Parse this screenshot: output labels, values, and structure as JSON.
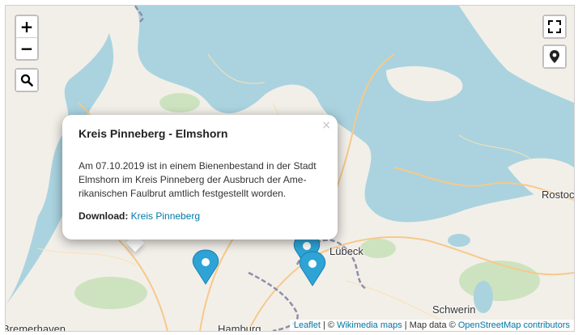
{
  "map": {
    "places": {
      "luebeck": "Lübeck",
      "rostock": "Rostoc",
      "schwerin": "Schwerin",
      "hamburg": "Hamburg",
      "bremerhaven": "Bremerhaven"
    },
    "colors": {
      "water": "#aad3df",
      "land": "#f2efe9",
      "forest": "#cde3bf",
      "road": "#f6c98a",
      "border": "#8e8ea8",
      "marker": "#2ea4d6"
    }
  },
  "controls": {
    "zoom_in": "+",
    "zoom_out": "−",
    "search_icon": "search-icon",
    "fullscreen_icon": "fullscreen-icon",
    "locate_icon": "map-pin-icon"
  },
  "popup": {
    "title": "Kreis Pinneberg - Elmshorn",
    "body": "Am 07.10.2019 ist in einem Bienenbestand in der Stadt Elmshorn im Kreis Pinneberg der Ausbruch der Ame-rikanischen Faulbrut amtlich festgestellt worden.",
    "download_label": "Download:",
    "download_link": "Kreis Pinneberg",
    "close": "×"
  },
  "attribution": {
    "leaflet": "Leaflet",
    "separator": " | © ",
    "wikimedia": "Wikimedia maps",
    "mapdata": " | Map data © ",
    "osm": "OpenStreetMap contributors"
  },
  "markers": [
    {
      "name": "Elmshorn"
    },
    {
      "name": "Lübeck-area-1"
    },
    {
      "name": "Lübeck-area-2"
    }
  ]
}
